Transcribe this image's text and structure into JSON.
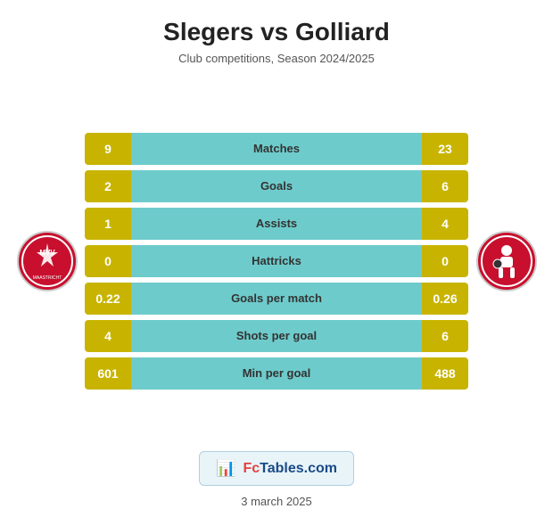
{
  "header": {
    "title": "Slegers vs Golliard",
    "subtitle": "Club competitions, Season 2024/2025"
  },
  "stats": [
    {
      "label": "Matches",
      "left": "9",
      "right": "23"
    },
    {
      "label": "Goals",
      "left": "2",
      "right": "6"
    },
    {
      "label": "Assists",
      "left": "1",
      "right": "4"
    },
    {
      "label": "Hattricks",
      "left": "0",
      "right": "0"
    },
    {
      "label": "Goals per match",
      "left": "0.22",
      "right": "0.26"
    },
    {
      "label": "Shots per goal",
      "left": "4",
      "right": "6"
    },
    {
      "label": "Min per goal",
      "left": "601",
      "right": "488"
    }
  ],
  "branding": {
    "icon": "📊",
    "text_fc": "Fc",
    "text_tables": "Tables.com"
  },
  "footer": {
    "date": "3 march 2025"
  }
}
